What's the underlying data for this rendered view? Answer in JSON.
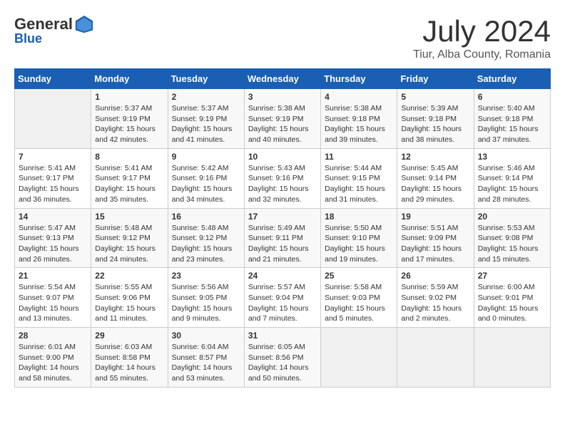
{
  "logo": {
    "general": "General",
    "blue": "Blue"
  },
  "header": {
    "month": "July 2024",
    "location": "Tiur, Alba County, Romania"
  },
  "days_of_week": [
    "Sunday",
    "Monday",
    "Tuesday",
    "Wednesday",
    "Thursday",
    "Friday",
    "Saturday"
  ],
  "weeks": [
    [
      {
        "day": "",
        "info": ""
      },
      {
        "day": "1",
        "info": "Sunrise: 5:37 AM\nSunset: 9:19 PM\nDaylight: 15 hours\nand 42 minutes."
      },
      {
        "day": "2",
        "info": "Sunrise: 5:37 AM\nSunset: 9:19 PM\nDaylight: 15 hours\nand 41 minutes."
      },
      {
        "day": "3",
        "info": "Sunrise: 5:38 AM\nSunset: 9:19 PM\nDaylight: 15 hours\nand 40 minutes."
      },
      {
        "day": "4",
        "info": "Sunrise: 5:38 AM\nSunset: 9:18 PM\nDaylight: 15 hours\nand 39 minutes."
      },
      {
        "day": "5",
        "info": "Sunrise: 5:39 AM\nSunset: 9:18 PM\nDaylight: 15 hours\nand 38 minutes."
      },
      {
        "day": "6",
        "info": "Sunrise: 5:40 AM\nSunset: 9:18 PM\nDaylight: 15 hours\nand 37 minutes."
      }
    ],
    [
      {
        "day": "7",
        "info": "Sunrise: 5:41 AM\nSunset: 9:17 PM\nDaylight: 15 hours\nand 36 minutes."
      },
      {
        "day": "8",
        "info": "Sunrise: 5:41 AM\nSunset: 9:17 PM\nDaylight: 15 hours\nand 35 minutes."
      },
      {
        "day": "9",
        "info": "Sunrise: 5:42 AM\nSunset: 9:16 PM\nDaylight: 15 hours\nand 34 minutes."
      },
      {
        "day": "10",
        "info": "Sunrise: 5:43 AM\nSunset: 9:16 PM\nDaylight: 15 hours\nand 32 minutes."
      },
      {
        "day": "11",
        "info": "Sunrise: 5:44 AM\nSunset: 9:15 PM\nDaylight: 15 hours\nand 31 minutes."
      },
      {
        "day": "12",
        "info": "Sunrise: 5:45 AM\nSunset: 9:14 PM\nDaylight: 15 hours\nand 29 minutes."
      },
      {
        "day": "13",
        "info": "Sunrise: 5:46 AM\nSunset: 9:14 PM\nDaylight: 15 hours\nand 28 minutes."
      }
    ],
    [
      {
        "day": "14",
        "info": "Sunrise: 5:47 AM\nSunset: 9:13 PM\nDaylight: 15 hours\nand 26 minutes."
      },
      {
        "day": "15",
        "info": "Sunrise: 5:48 AM\nSunset: 9:12 PM\nDaylight: 15 hours\nand 24 minutes."
      },
      {
        "day": "16",
        "info": "Sunrise: 5:48 AM\nSunset: 9:12 PM\nDaylight: 15 hours\nand 23 minutes."
      },
      {
        "day": "17",
        "info": "Sunrise: 5:49 AM\nSunset: 9:11 PM\nDaylight: 15 hours\nand 21 minutes."
      },
      {
        "day": "18",
        "info": "Sunrise: 5:50 AM\nSunset: 9:10 PM\nDaylight: 15 hours\nand 19 minutes."
      },
      {
        "day": "19",
        "info": "Sunrise: 5:51 AM\nSunset: 9:09 PM\nDaylight: 15 hours\nand 17 minutes."
      },
      {
        "day": "20",
        "info": "Sunrise: 5:53 AM\nSunset: 9:08 PM\nDaylight: 15 hours\nand 15 minutes."
      }
    ],
    [
      {
        "day": "21",
        "info": "Sunrise: 5:54 AM\nSunset: 9:07 PM\nDaylight: 15 hours\nand 13 minutes."
      },
      {
        "day": "22",
        "info": "Sunrise: 5:55 AM\nSunset: 9:06 PM\nDaylight: 15 hours\nand 11 minutes."
      },
      {
        "day": "23",
        "info": "Sunrise: 5:56 AM\nSunset: 9:05 PM\nDaylight: 15 hours\nand 9 minutes."
      },
      {
        "day": "24",
        "info": "Sunrise: 5:57 AM\nSunset: 9:04 PM\nDaylight: 15 hours\nand 7 minutes."
      },
      {
        "day": "25",
        "info": "Sunrise: 5:58 AM\nSunset: 9:03 PM\nDaylight: 15 hours\nand 5 minutes."
      },
      {
        "day": "26",
        "info": "Sunrise: 5:59 AM\nSunset: 9:02 PM\nDaylight: 15 hours\nand 2 minutes."
      },
      {
        "day": "27",
        "info": "Sunrise: 6:00 AM\nSunset: 9:01 PM\nDaylight: 15 hours\nand 0 minutes."
      }
    ],
    [
      {
        "day": "28",
        "info": "Sunrise: 6:01 AM\nSunset: 9:00 PM\nDaylight: 14 hours\nand 58 minutes."
      },
      {
        "day": "29",
        "info": "Sunrise: 6:03 AM\nSunset: 8:58 PM\nDaylight: 14 hours\nand 55 minutes."
      },
      {
        "day": "30",
        "info": "Sunrise: 6:04 AM\nSunset: 8:57 PM\nDaylight: 14 hours\nand 53 minutes."
      },
      {
        "day": "31",
        "info": "Sunrise: 6:05 AM\nSunset: 8:56 PM\nDaylight: 14 hours\nand 50 minutes."
      },
      {
        "day": "",
        "info": ""
      },
      {
        "day": "",
        "info": ""
      },
      {
        "day": "",
        "info": ""
      }
    ]
  ]
}
